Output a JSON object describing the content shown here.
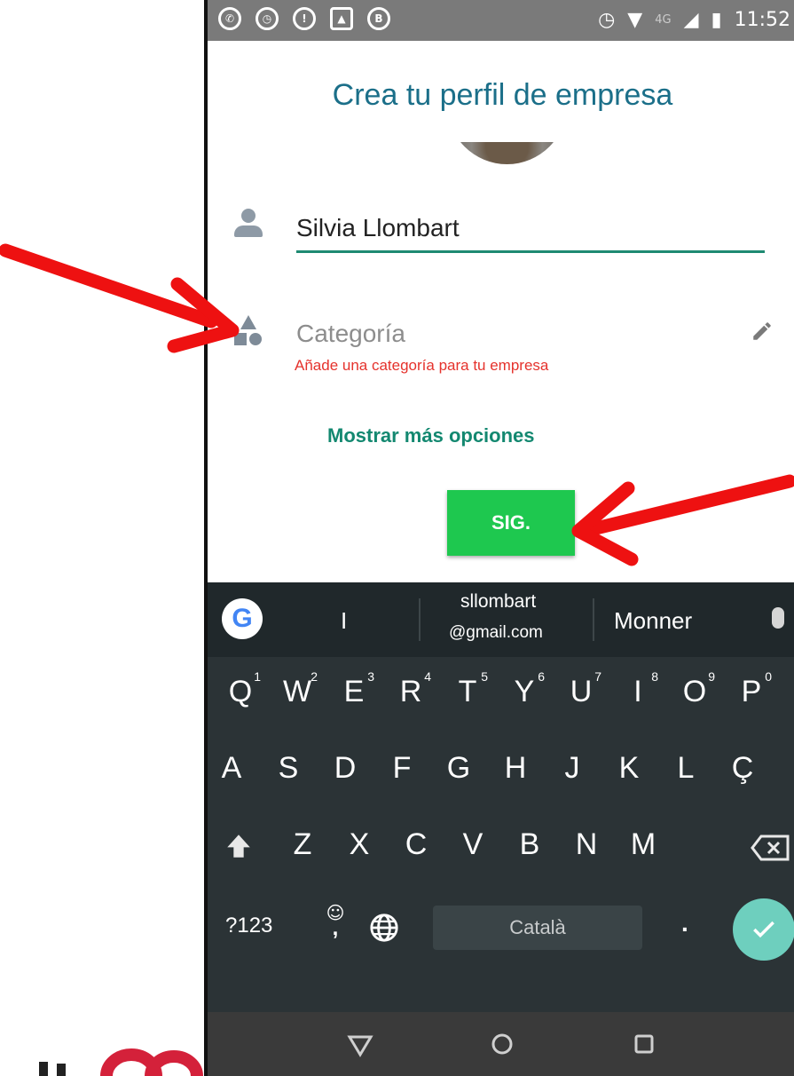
{
  "status_bar": {
    "time": "11:52",
    "network": "4G"
  },
  "profile": {
    "title": "Crea tu perfil de empresa",
    "name_value": "Silvia Llombart",
    "category_label": "Categoría",
    "category_error": "Añade una categoría para tu empresa",
    "more_options": "Mostrar más opciones",
    "next_button": "SIG."
  },
  "keyboard": {
    "suggestions": [
      "I",
      "sllombart",
      "@gmail.com",
      "Monner"
    ],
    "row1": [
      "Q",
      "W",
      "E",
      "R",
      "T",
      "Y",
      "U",
      "I",
      "O",
      "P"
    ],
    "row1_numbers": [
      "1",
      "2",
      "3",
      "4",
      "5",
      "6",
      "7",
      "8",
      "9",
      "0"
    ],
    "row2": [
      "A",
      "S",
      "D",
      "F",
      "G",
      "H",
      "J",
      "K",
      "L",
      "Ç"
    ],
    "row3": [
      "Z",
      "X",
      "C",
      "V",
      "B",
      "N",
      "M"
    ],
    "symbols_key": "?123",
    "comma_key": ",",
    "emoji_key": "☺",
    "period_key": ".",
    "space_label": "Català"
  },
  "colors": {
    "title": "#1b6f89",
    "accent_green": "#1ec84f",
    "error_red": "#e5322c",
    "link_teal": "#138870",
    "keyboard_bg": "#2b3336",
    "annotation_arrow": "#ee1111"
  },
  "icons": [
    "whatsapp-icon",
    "alarm-icon",
    "person-icon",
    "category-icon",
    "pencil-icon",
    "mic-icon",
    "shift-icon",
    "backspace-icon",
    "globe-icon",
    "check-icon",
    "back-icon",
    "home-icon",
    "recents-icon"
  ]
}
